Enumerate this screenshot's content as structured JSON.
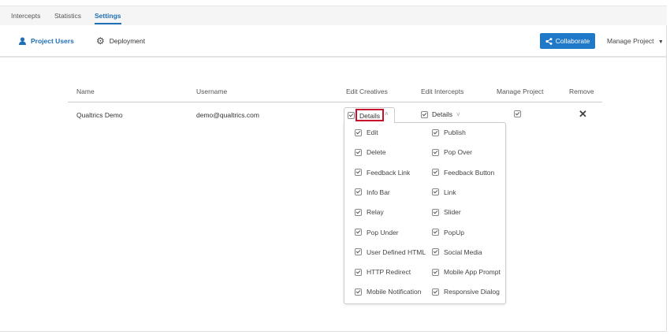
{
  "tabs": [
    {
      "label": "Intercepts"
    },
    {
      "label": "Statistics"
    },
    {
      "label": "Settings",
      "active": true
    }
  ],
  "subnav": {
    "project_users": "Project Users",
    "deployment": "Deployment",
    "collaborate": "Collaborate",
    "manage_project": "Manage Project"
  },
  "table": {
    "headers": [
      "Name",
      "Username",
      "Edit Creatives",
      "Edit Intercepts",
      "Manage Project",
      "Remove"
    ],
    "row": {
      "name": "Qualtrics Demo",
      "username": "demo@qualtrics.com",
      "edit_creatives": "Details",
      "edit_intercepts": "Details"
    }
  },
  "dropdown": {
    "left": [
      "Edit",
      "Delete",
      "Feedback Link",
      "Info Bar",
      "Relay",
      "Pop Under",
      "User Defined HTML",
      "HTTP Redirect",
      "Mobile Notification"
    ],
    "right": [
      "Publish",
      "Pop Over",
      "Feedback Button",
      "Link",
      "Slider",
      "PopUp",
      "Social Media",
      "Mobile App Prompt",
      "Responsive Dialog"
    ]
  },
  "colors": {
    "accent": "#1f78c8",
    "highlight": "#c8102e"
  }
}
